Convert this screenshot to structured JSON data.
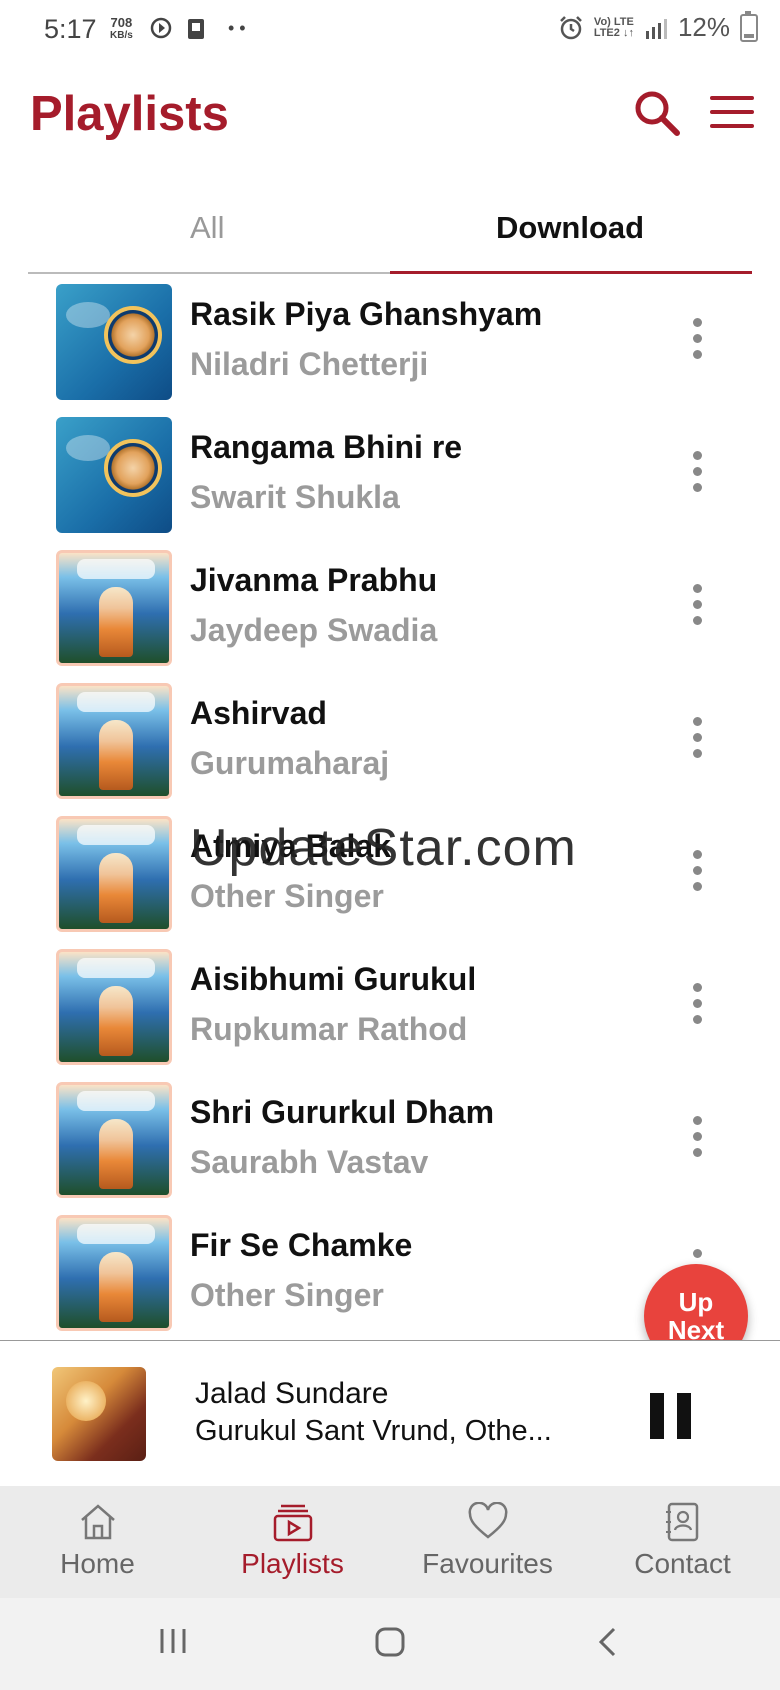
{
  "status_bar": {
    "time": "5:17",
    "net_speed_value": "708",
    "net_speed_unit": "KB/s",
    "dots": "• •",
    "lte_top": "Vo) LTE",
    "lte_bottom": "LTE2 ↓↑",
    "battery": "12%"
  },
  "header": {
    "title": "Playlists",
    "search_icon": "search-icon",
    "menu_icon": "menu-icon"
  },
  "tabs": [
    {
      "label": "All",
      "active": false
    },
    {
      "label": "Download",
      "active": true
    }
  ],
  "songs": [
    {
      "title": "Rasik Piya Ghanshyam",
      "artist": "Niladri Chetterji",
      "art": "blue"
    },
    {
      "title": "Rangama Bhini re",
      "artist": "Swarit Shukla",
      "art": "blue"
    },
    {
      "title": "Jivanma Prabhu",
      "artist": "Jaydeep Swadia",
      "art": "scene"
    },
    {
      "title": "Ashirvad",
      "artist": "Gurumaharaj",
      "art": "scene"
    },
    {
      "title": "Atmiya Balak",
      "artist": "Other Singer",
      "art": "scene"
    },
    {
      "title": "Aisibhumi Gurukul",
      "artist": "Rupkumar Rathod",
      "art": "scene"
    },
    {
      "title": "Shri Gururkul Dham",
      "artist": "Saurabh Vastav",
      "art": "scene"
    },
    {
      "title": "Fir Se Chamke",
      "artist": "Other Singer",
      "art": "scene"
    }
  ],
  "watermark": "UpdateStar.com",
  "up_next": {
    "line1": "Up",
    "line2": "Next"
  },
  "now_playing": {
    "title": "Jalad Sundare",
    "subtitle": "Gurukul Sant Vrund, Othe...",
    "state": "playing"
  },
  "bottom_nav": [
    {
      "label": "Home",
      "icon": "home-icon",
      "active": false
    },
    {
      "label": "Playlists",
      "icon": "playlist-icon",
      "active": true
    },
    {
      "label": "Favourites",
      "icon": "heart-icon",
      "active": false
    },
    {
      "label": "Contact",
      "icon": "contact-book-icon",
      "active": false
    }
  ],
  "colors": {
    "accent": "#a51c2b",
    "up_next": "#e8433d",
    "muted_text": "#9b9b9b"
  }
}
